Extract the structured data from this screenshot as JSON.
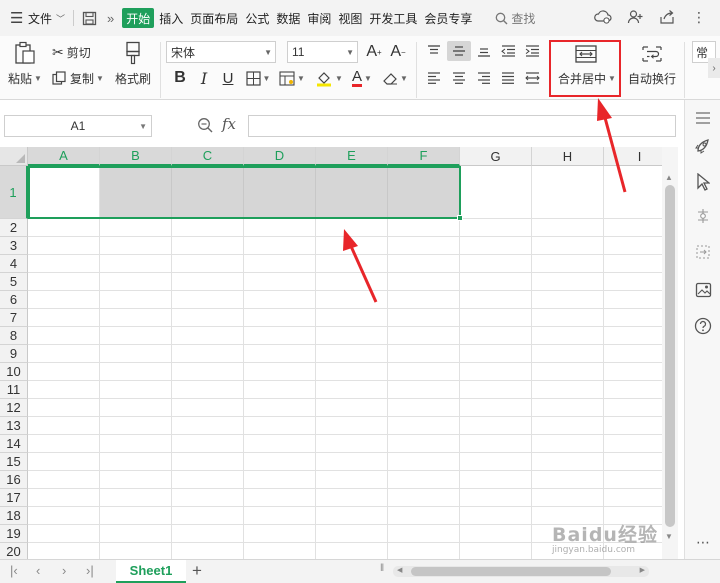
{
  "menubar": {
    "file_label": "文件",
    "tabs": [
      "开始",
      "插入",
      "页面布局",
      "公式",
      "数据",
      "审阅",
      "视图",
      "开发工具",
      "会员专享"
    ],
    "active_tab": "开始",
    "search_label": "查找"
  },
  "ribbon": {
    "paste_label": "粘贴",
    "cut_label": "剪切",
    "copy_label": "复制",
    "format_painter_label": "格式刷",
    "font_name": "宋体",
    "font_size": "11",
    "bold": "B",
    "italic": "I",
    "underline": "U",
    "font_color_glyph": "A",
    "merge_center_label": "合并居中",
    "wrap_text_label": "自动换行",
    "normal_style_label": "常"
  },
  "formula_bar": {
    "cell_ref": "A1",
    "fx_label": "fx",
    "formula_value": ""
  },
  "grid": {
    "columns": [
      "A",
      "B",
      "C",
      "D",
      "E",
      "F",
      "G",
      "H",
      "I"
    ],
    "rows": [
      "1",
      "2",
      "3",
      "4",
      "5",
      "6",
      "7",
      "8",
      "9",
      "10",
      "11",
      "12",
      "13",
      "14",
      "15",
      "16",
      "17",
      "18",
      "19",
      "20"
    ],
    "selected_range": "A1:F1"
  },
  "sheets": {
    "tabs": [
      "Sheet1"
    ],
    "active": "Sheet1"
  },
  "watermark": {
    "text": "Baidu经验",
    "sub": "jingyan.baidu.com"
  },
  "colors": {
    "accent": "#1e9f5b",
    "highlight_box": "#e8262a",
    "arrow": "#e8262a",
    "selection_fill": "#d6d6d6"
  }
}
